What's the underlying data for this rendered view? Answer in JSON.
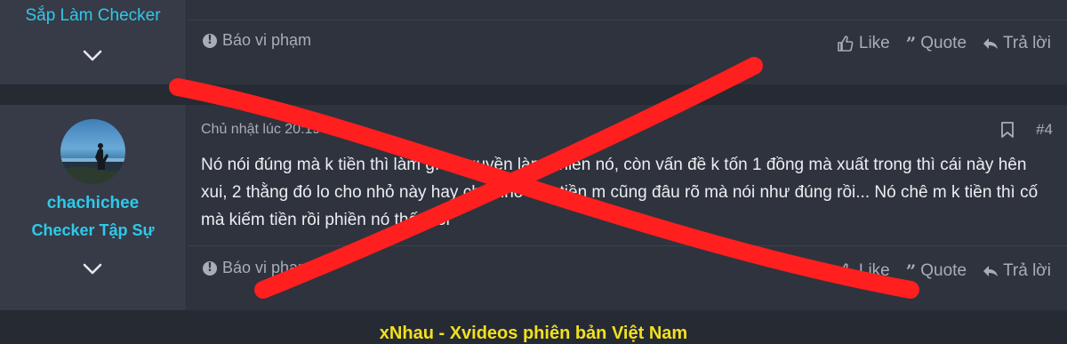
{
  "post1": {
    "user_title": "Sắp Làm Checker",
    "actions": {
      "report": "Báo vi phạm",
      "like": "Like",
      "quote": "Quote",
      "reply": "Trả lời"
    }
  },
  "post2": {
    "username": "chachichee",
    "user_title": "Checker Tập Sự",
    "date": "Chủ nhật lúc 20:19",
    "post_number": "#4",
    "content": "Nó nói đúng mà k tiền thì làm gì có quyền làm phiền nó, còn vấn đề k tốn 1 đồng mà xuất trong thì cái này hên xui, 2 thằng đó lo cho nhỏ này hay cho nhỏ này tiền m cũng đâu rõ mà nói như đúng rồi... Nó chê m k tiền thì cố mà kiếm tiền rồi phiền nó thế thôi",
    "actions": {
      "report": "Báo vi phạm",
      "like": "Like",
      "quote": "Quote",
      "reply": "Trả lời"
    }
  },
  "footer": {
    "link_text": "xNhau - Xvideos phiên bản Việt Nam"
  },
  "colors": {
    "accent": "#2fc9e9",
    "strike": "#ff1f1f",
    "footer_link": "#f1e020"
  }
}
